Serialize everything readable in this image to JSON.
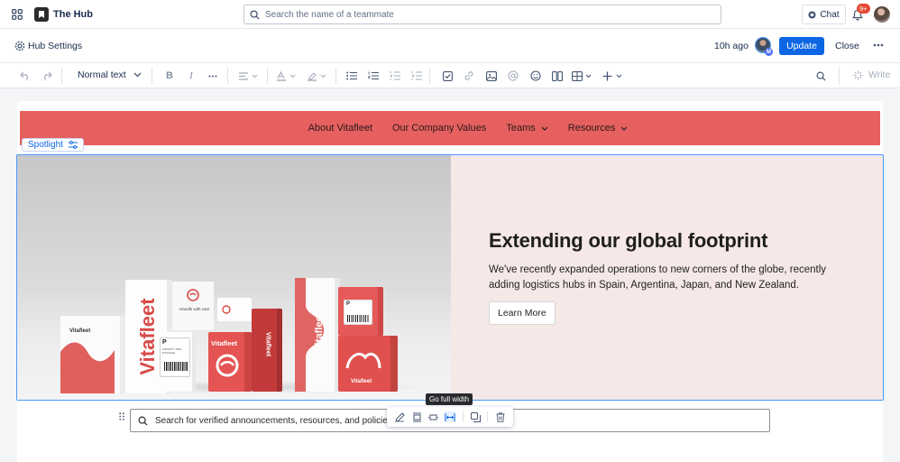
{
  "app": {
    "title": "The Hub"
  },
  "topbar": {
    "search_placeholder": "Search the name of a teammate",
    "chat_label": "Chat",
    "notification_count": "9+"
  },
  "header": {
    "settings_label": "Hub Settings",
    "last_edited": "10h ago",
    "collaborator_badge": "M",
    "update_label": "Update",
    "close_label": "Close"
  },
  "toolbar": {
    "text_style": "Normal text",
    "write_label": "Write"
  },
  "nav": {
    "items": [
      "About Vitafleet",
      "Our Company Values",
      "Teams",
      "Resources"
    ]
  },
  "spotlight": {
    "label": "Spotlight",
    "title": "Extending our global footprint",
    "body": "We've recently expanded operations to new corners of the globe, recently adding logistics hubs in Spain, Argentina, Japan, and New Zealand.",
    "button_label": "Learn More",
    "image_texts": {
      "brand": "Vitafleet",
      "handle": "Handle with care",
      "priority": "PRIORITY MAIL POSTAGE",
      "label_p": "P"
    }
  },
  "block_toolbar": {
    "tooltip": "Go full width"
  },
  "search_block": {
    "placeholder": "Search for verified announcements, resources, and policies"
  },
  "colors": {
    "accent": "#0c66e4",
    "nav_bg": "#e66060",
    "hero_bg": "#f5e8e6",
    "brand_red": "#d94a48"
  }
}
